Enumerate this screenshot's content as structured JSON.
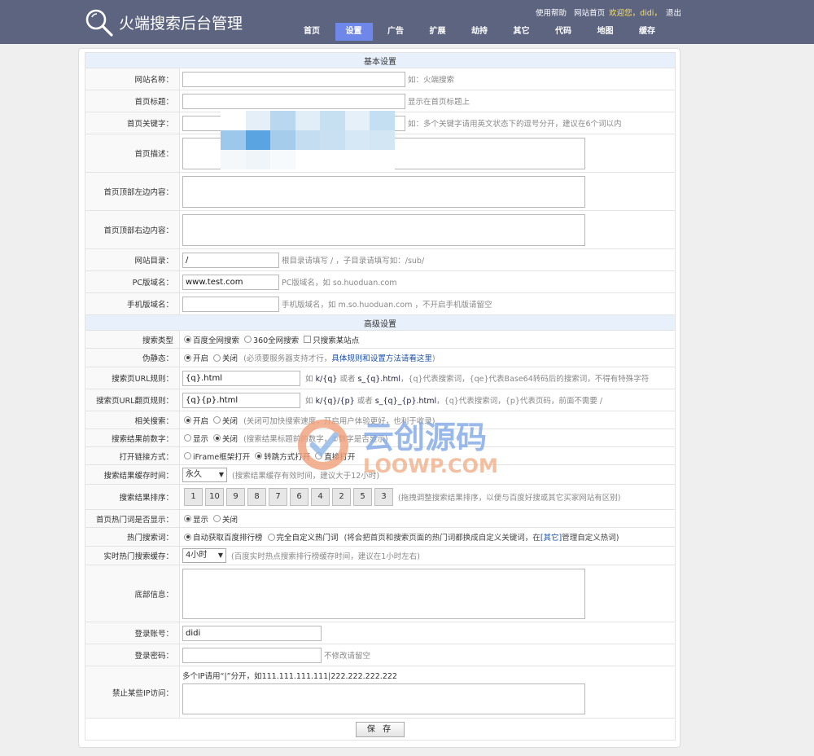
{
  "header": {
    "title": "火端搜索后台管理",
    "links": {
      "help": "使用帮助",
      "home": "网站首页",
      "welcome": "欢迎您，didi，",
      "logout": "退出"
    },
    "nav": [
      "首页",
      "设置",
      "广告",
      "扩展",
      "劫持",
      "其它",
      "代码",
      "地图",
      "缓存"
    ],
    "nav_active": "设置"
  },
  "basic": {
    "section_title": "基本设置",
    "site_name": {
      "label": "网站名称：",
      "value": "",
      "hint": "如：火端搜索"
    },
    "home_title": {
      "label": "首页标题：",
      "value": "",
      "hint": "显示在首页标题上"
    },
    "home_keywords": {
      "label": "首页关键字：",
      "value": "",
      "hint": "如：多个关键字请用英文状态下的逗号分开，建议在6个词以内"
    },
    "home_desc": {
      "label": "首页描述："
    },
    "home_top_left": {
      "label": "首页顶部左边内容："
    },
    "home_top_right": {
      "label": "首页顶部右边内容："
    },
    "site_dir": {
      "label": "网站目录：",
      "value": "/",
      "hint": "根目录请填写 / ，子目录请填写如：/sub/"
    },
    "pc_domain": {
      "label": "PC版域名：",
      "value": "www.test.com",
      "hint": "PC版域名，如 so.huoduan.com"
    },
    "mobile_domain": {
      "label": "手机版域名：",
      "value": "",
      "hint": "手机版域名，如 m.so.huoduan.com ，不开启手机版请留空"
    }
  },
  "advanced": {
    "section_title": "高级设置",
    "search_type": {
      "label": "搜索类型",
      "opt1": "百度全网搜索",
      "opt2": "360全网搜索",
      "opt3": "只搜索某站点"
    },
    "pseudo_static": {
      "label": "伪静态：",
      "on": "开启",
      "off": "关闭",
      "hint": "(必须要服务器支持才行，",
      "link": "具体规则和设置方法请看这里",
      "hint_end": ")"
    },
    "url_rule": {
      "label": "搜索页URL规则：",
      "value": "{q}.html",
      "hint_pre": "如",
      "ex1": "k/{q}",
      "or": "或者",
      "ex2": "s_{q}.html",
      "hint": "，{q}代表搜索词，{qe}代表Base64转码后的搜索词，不得有特殊字符"
    },
    "url_page_rule": {
      "label": "搜索页URL翻页规则：",
      "value": "{q}{p}.html",
      "hint_pre": "如",
      "ex1": "k/{q}/{p}",
      "or": "或者",
      "ex2": "s_{q}_{p}.html",
      "hint": "，{q}代表搜索词，{p}代表页码，前面不需要 /"
    },
    "related": {
      "label": "相关搜索：",
      "on": "开启",
      "off": "关闭",
      "hint": "(关闭可加快搜索速度，开启用户体验更好，也利于收录)"
    },
    "result_num": {
      "label": "搜索结果前数字：",
      "on": "显示",
      "off": "关闭",
      "hint": "(搜索结果标题前的数字，①数字是否显示)"
    },
    "open_link": {
      "label": "打开链接方式：",
      "opt1": "iFrame框架打开",
      "opt2": "转跳方式打开",
      "opt3": "直接打开"
    },
    "cache_time": {
      "label": "搜索结果缓存时间：",
      "value": "永久",
      "hint": "(搜索结果缓存有效时间，建议大于12小时)"
    },
    "sort": {
      "label": "搜索结果排序：",
      "items": [
        "1",
        "10",
        "9",
        "8",
        "7",
        "6",
        "4",
        "2",
        "5",
        "3"
      ],
      "hint": "(拖拽调整搜索结果排序，以便与百度好搜或其它买家网站有区别)"
    },
    "hot_show": {
      "label": "首页热门词是否显示：",
      "on": "显示",
      "off": "关闭"
    },
    "hot_words": {
      "label": "热门搜索词：",
      "opt1": "自动获取百度排行榜",
      "opt2": "完全自定义热门词",
      "hint": "(将会把首页和搜索页面的热门词都换成自定义关键词，在",
      "link": "[其它]",
      "hint_end": "管理自定义热词)"
    },
    "hot_cache": {
      "label": "实时热门搜索缓存：",
      "value": "4小时",
      "hint": "(百度实时热点搜索排行榜缓存时间，建议在1小时左右)"
    },
    "footer": {
      "label": "底部信息："
    },
    "login_user": {
      "label": "登录账号：",
      "value": "didi"
    },
    "login_pass": {
      "label": "登录密码：",
      "value": "",
      "hint": "不修改请留空"
    },
    "block_ip": {
      "label": "禁止某些IP访问：",
      "hint": "多个IP请用“|”分开，如111.111.111.111|222.222.222.222"
    },
    "save_label": "保 存"
  },
  "watermark": {
    "text": "云创源码",
    "url": "LOOWP.COM"
  },
  "colors": {
    "topbar": "#5d6480",
    "nav_active": "#6f87e8",
    "section_bg": "#e8f0fb",
    "link": "#1a4fa8"
  }
}
